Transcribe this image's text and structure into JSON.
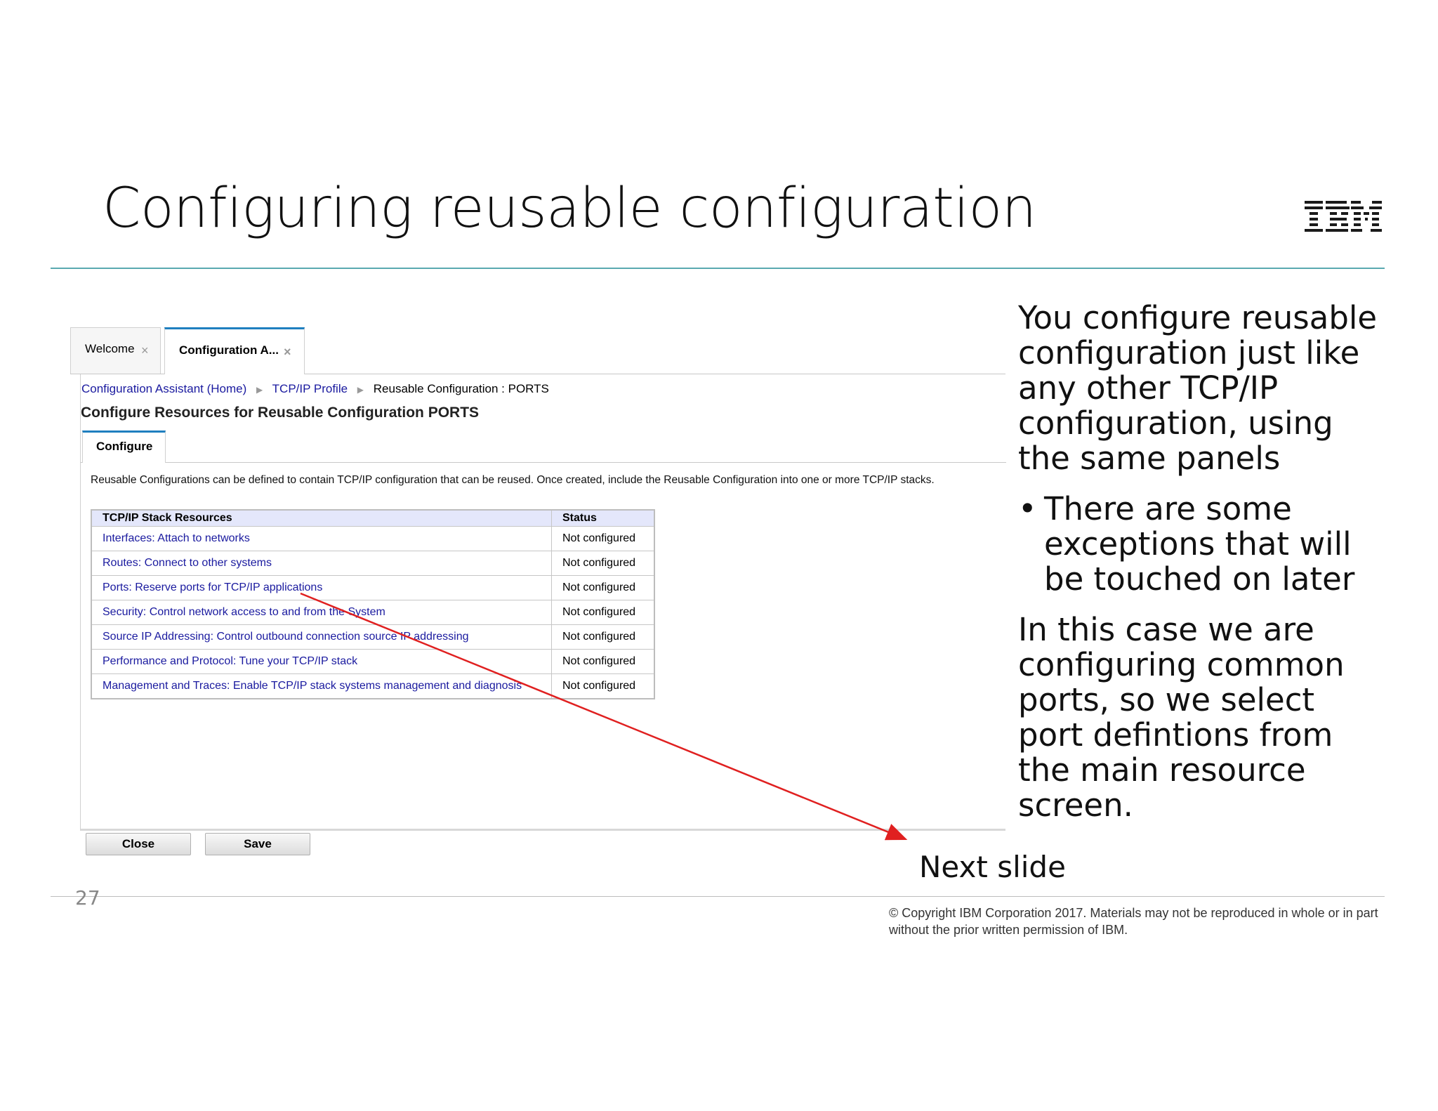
{
  "slide": {
    "title": "Configuring reusable configuration",
    "logo_text": "IBM",
    "page_number": "27",
    "copyright": "© Copyright IBM Corporation 2017. Materials may not be reproduced in whole or in part without the prior written permission of IBM.",
    "next_slide_label": "Next slide",
    "accent_color": "#5aa9b0"
  },
  "right_text": {
    "para1": "You configure reusable configuration just like any other TCP/IP configuration, using the same panels",
    "bullet1": "There are some exceptions that will be touched on later",
    "para2": "In this case we are configuring common ports, so we select port defintions from the main resource screen."
  },
  "ui": {
    "tabs": [
      {
        "label": "Welcome",
        "close": "×"
      },
      {
        "label": "Configuration A...",
        "close": "×"
      }
    ],
    "breadcrumb": [
      {
        "label": "Configuration Assistant (Home)"
      },
      {
        "label": "TCP/IP Profile"
      },
      {
        "label": "Reusable Configuration : PORTS"
      }
    ],
    "heading": "Configure Resources for Reusable Configuration PORTS",
    "subtab": "Configure",
    "description": "Reusable Configurations can be defined to contain TCP/IP configuration that can be reused. Once created, include the Reusable Configuration into one or more TCP/IP stacks.",
    "table": {
      "headers": [
        "TCP/IP Stack Resources",
        "Status"
      ],
      "rows": [
        {
          "resource": "Interfaces: Attach to networks",
          "status": "Not configured"
        },
        {
          "resource": "Routes: Connect to other systems",
          "status": "Not configured"
        },
        {
          "resource": "Ports: Reserve ports for TCP/IP applications",
          "status": "Not configured"
        },
        {
          "resource": "Security: Control network access to and from the System",
          "status": "Not configured"
        },
        {
          "resource": "Source IP Addressing: Control outbound connection source IP addressing",
          "status": "Not configured"
        },
        {
          "resource": "Performance and Protocol: Tune your TCP/IP stack",
          "status": "Not configured"
        },
        {
          "resource": "Management and Traces: Enable TCP/IP stack systems management and diagnosis",
          "status": "Not configured"
        }
      ]
    },
    "buttons": {
      "close": "Close",
      "save": "Save"
    },
    "link_color": "#1a1a9f",
    "annotation_color": "#e02020"
  }
}
